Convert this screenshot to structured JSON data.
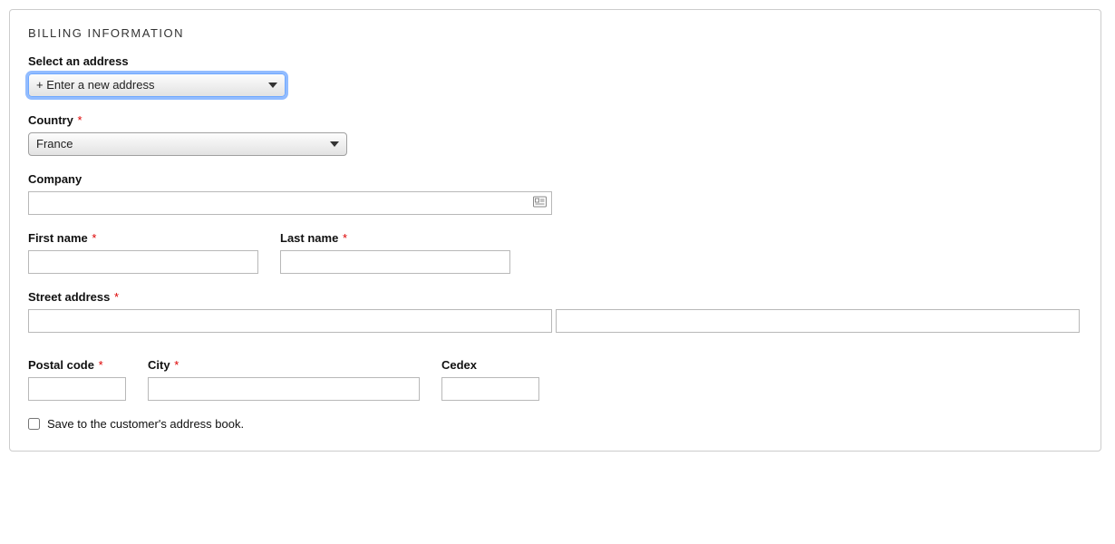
{
  "panel": {
    "title": "BILLING INFORMATION",
    "selectAddress": {
      "label": "Select an address",
      "value": "+ Enter a new address"
    },
    "country": {
      "label": "Country",
      "required": "*",
      "value": "France"
    },
    "company": {
      "label": "Company"
    },
    "firstName": {
      "label": "First name",
      "required": "*"
    },
    "lastName": {
      "label": "Last name",
      "required": "*"
    },
    "street": {
      "label": "Street address",
      "required": "*"
    },
    "postal": {
      "label": "Postal code",
      "required": "*"
    },
    "city": {
      "label": "City",
      "required": "*"
    },
    "cedex": {
      "label": "Cedex"
    },
    "saveAddress": {
      "label": "Save to the customer's address book."
    }
  }
}
